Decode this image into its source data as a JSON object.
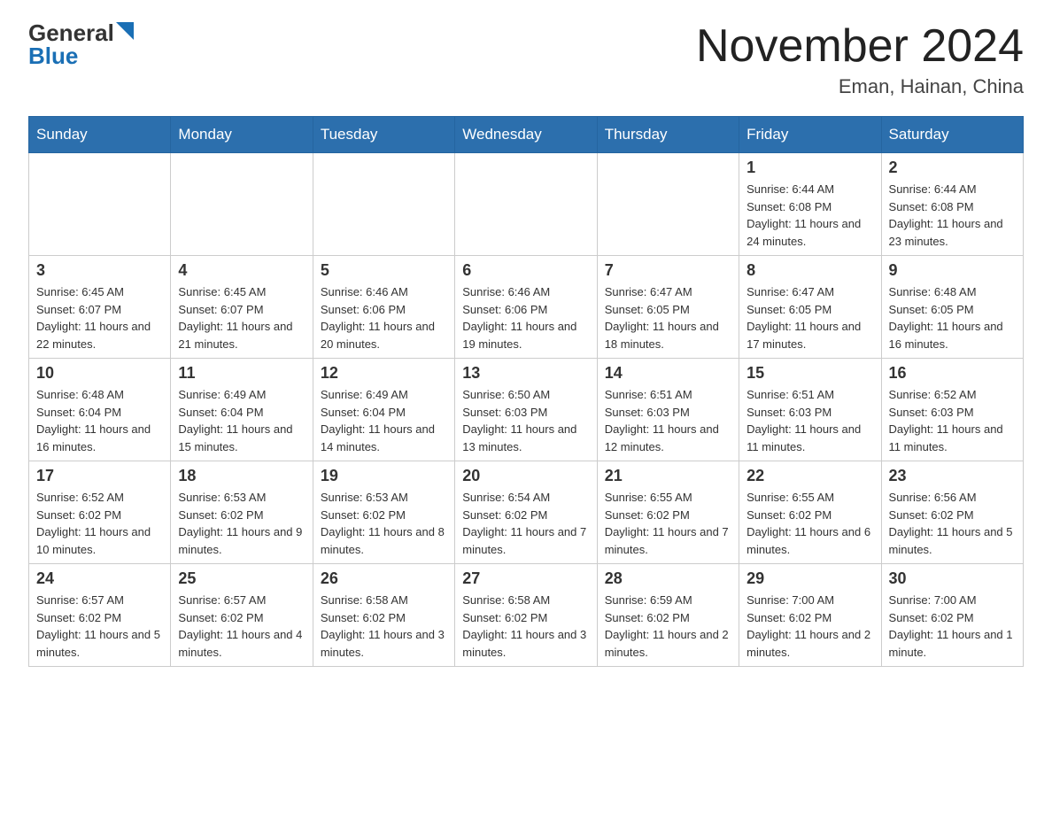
{
  "header": {
    "logo": {
      "general": "General",
      "blue": "Blue"
    },
    "title": "November 2024",
    "location": "Eman, Hainan, China"
  },
  "days_of_week": [
    "Sunday",
    "Monday",
    "Tuesday",
    "Wednesday",
    "Thursday",
    "Friday",
    "Saturday"
  ],
  "weeks": [
    [
      {
        "day": "",
        "info": ""
      },
      {
        "day": "",
        "info": ""
      },
      {
        "day": "",
        "info": ""
      },
      {
        "day": "",
        "info": ""
      },
      {
        "day": "",
        "info": ""
      },
      {
        "day": "1",
        "info": "Sunrise: 6:44 AM\nSunset: 6:08 PM\nDaylight: 11 hours and 24 minutes."
      },
      {
        "day": "2",
        "info": "Sunrise: 6:44 AM\nSunset: 6:08 PM\nDaylight: 11 hours and 23 minutes."
      }
    ],
    [
      {
        "day": "3",
        "info": "Sunrise: 6:45 AM\nSunset: 6:07 PM\nDaylight: 11 hours and 22 minutes."
      },
      {
        "day": "4",
        "info": "Sunrise: 6:45 AM\nSunset: 6:07 PM\nDaylight: 11 hours and 21 minutes."
      },
      {
        "day": "5",
        "info": "Sunrise: 6:46 AM\nSunset: 6:06 PM\nDaylight: 11 hours and 20 minutes."
      },
      {
        "day": "6",
        "info": "Sunrise: 6:46 AM\nSunset: 6:06 PM\nDaylight: 11 hours and 19 minutes."
      },
      {
        "day": "7",
        "info": "Sunrise: 6:47 AM\nSunset: 6:05 PM\nDaylight: 11 hours and 18 minutes."
      },
      {
        "day": "8",
        "info": "Sunrise: 6:47 AM\nSunset: 6:05 PM\nDaylight: 11 hours and 17 minutes."
      },
      {
        "day": "9",
        "info": "Sunrise: 6:48 AM\nSunset: 6:05 PM\nDaylight: 11 hours and 16 minutes."
      }
    ],
    [
      {
        "day": "10",
        "info": "Sunrise: 6:48 AM\nSunset: 6:04 PM\nDaylight: 11 hours and 16 minutes."
      },
      {
        "day": "11",
        "info": "Sunrise: 6:49 AM\nSunset: 6:04 PM\nDaylight: 11 hours and 15 minutes."
      },
      {
        "day": "12",
        "info": "Sunrise: 6:49 AM\nSunset: 6:04 PM\nDaylight: 11 hours and 14 minutes."
      },
      {
        "day": "13",
        "info": "Sunrise: 6:50 AM\nSunset: 6:03 PM\nDaylight: 11 hours and 13 minutes."
      },
      {
        "day": "14",
        "info": "Sunrise: 6:51 AM\nSunset: 6:03 PM\nDaylight: 11 hours and 12 minutes."
      },
      {
        "day": "15",
        "info": "Sunrise: 6:51 AM\nSunset: 6:03 PM\nDaylight: 11 hours and 11 minutes."
      },
      {
        "day": "16",
        "info": "Sunrise: 6:52 AM\nSunset: 6:03 PM\nDaylight: 11 hours and 11 minutes."
      }
    ],
    [
      {
        "day": "17",
        "info": "Sunrise: 6:52 AM\nSunset: 6:02 PM\nDaylight: 11 hours and 10 minutes."
      },
      {
        "day": "18",
        "info": "Sunrise: 6:53 AM\nSunset: 6:02 PM\nDaylight: 11 hours and 9 minutes."
      },
      {
        "day": "19",
        "info": "Sunrise: 6:53 AM\nSunset: 6:02 PM\nDaylight: 11 hours and 8 minutes."
      },
      {
        "day": "20",
        "info": "Sunrise: 6:54 AM\nSunset: 6:02 PM\nDaylight: 11 hours and 7 minutes."
      },
      {
        "day": "21",
        "info": "Sunrise: 6:55 AM\nSunset: 6:02 PM\nDaylight: 11 hours and 7 minutes."
      },
      {
        "day": "22",
        "info": "Sunrise: 6:55 AM\nSunset: 6:02 PM\nDaylight: 11 hours and 6 minutes."
      },
      {
        "day": "23",
        "info": "Sunrise: 6:56 AM\nSunset: 6:02 PM\nDaylight: 11 hours and 5 minutes."
      }
    ],
    [
      {
        "day": "24",
        "info": "Sunrise: 6:57 AM\nSunset: 6:02 PM\nDaylight: 11 hours and 5 minutes."
      },
      {
        "day": "25",
        "info": "Sunrise: 6:57 AM\nSunset: 6:02 PM\nDaylight: 11 hours and 4 minutes."
      },
      {
        "day": "26",
        "info": "Sunrise: 6:58 AM\nSunset: 6:02 PM\nDaylight: 11 hours and 3 minutes."
      },
      {
        "day": "27",
        "info": "Sunrise: 6:58 AM\nSunset: 6:02 PM\nDaylight: 11 hours and 3 minutes."
      },
      {
        "day": "28",
        "info": "Sunrise: 6:59 AM\nSunset: 6:02 PM\nDaylight: 11 hours and 2 minutes."
      },
      {
        "day": "29",
        "info": "Sunrise: 7:00 AM\nSunset: 6:02 PM\nDaylight: 11 hours and 2 minutes."
      },
      {
        "day": "30",
        "info": "Sunrise: 7:00 AM\nSunset: 6:02 PM\nDaylight: 11 hours and 1 minute."
      }
    ]
  ]
}
